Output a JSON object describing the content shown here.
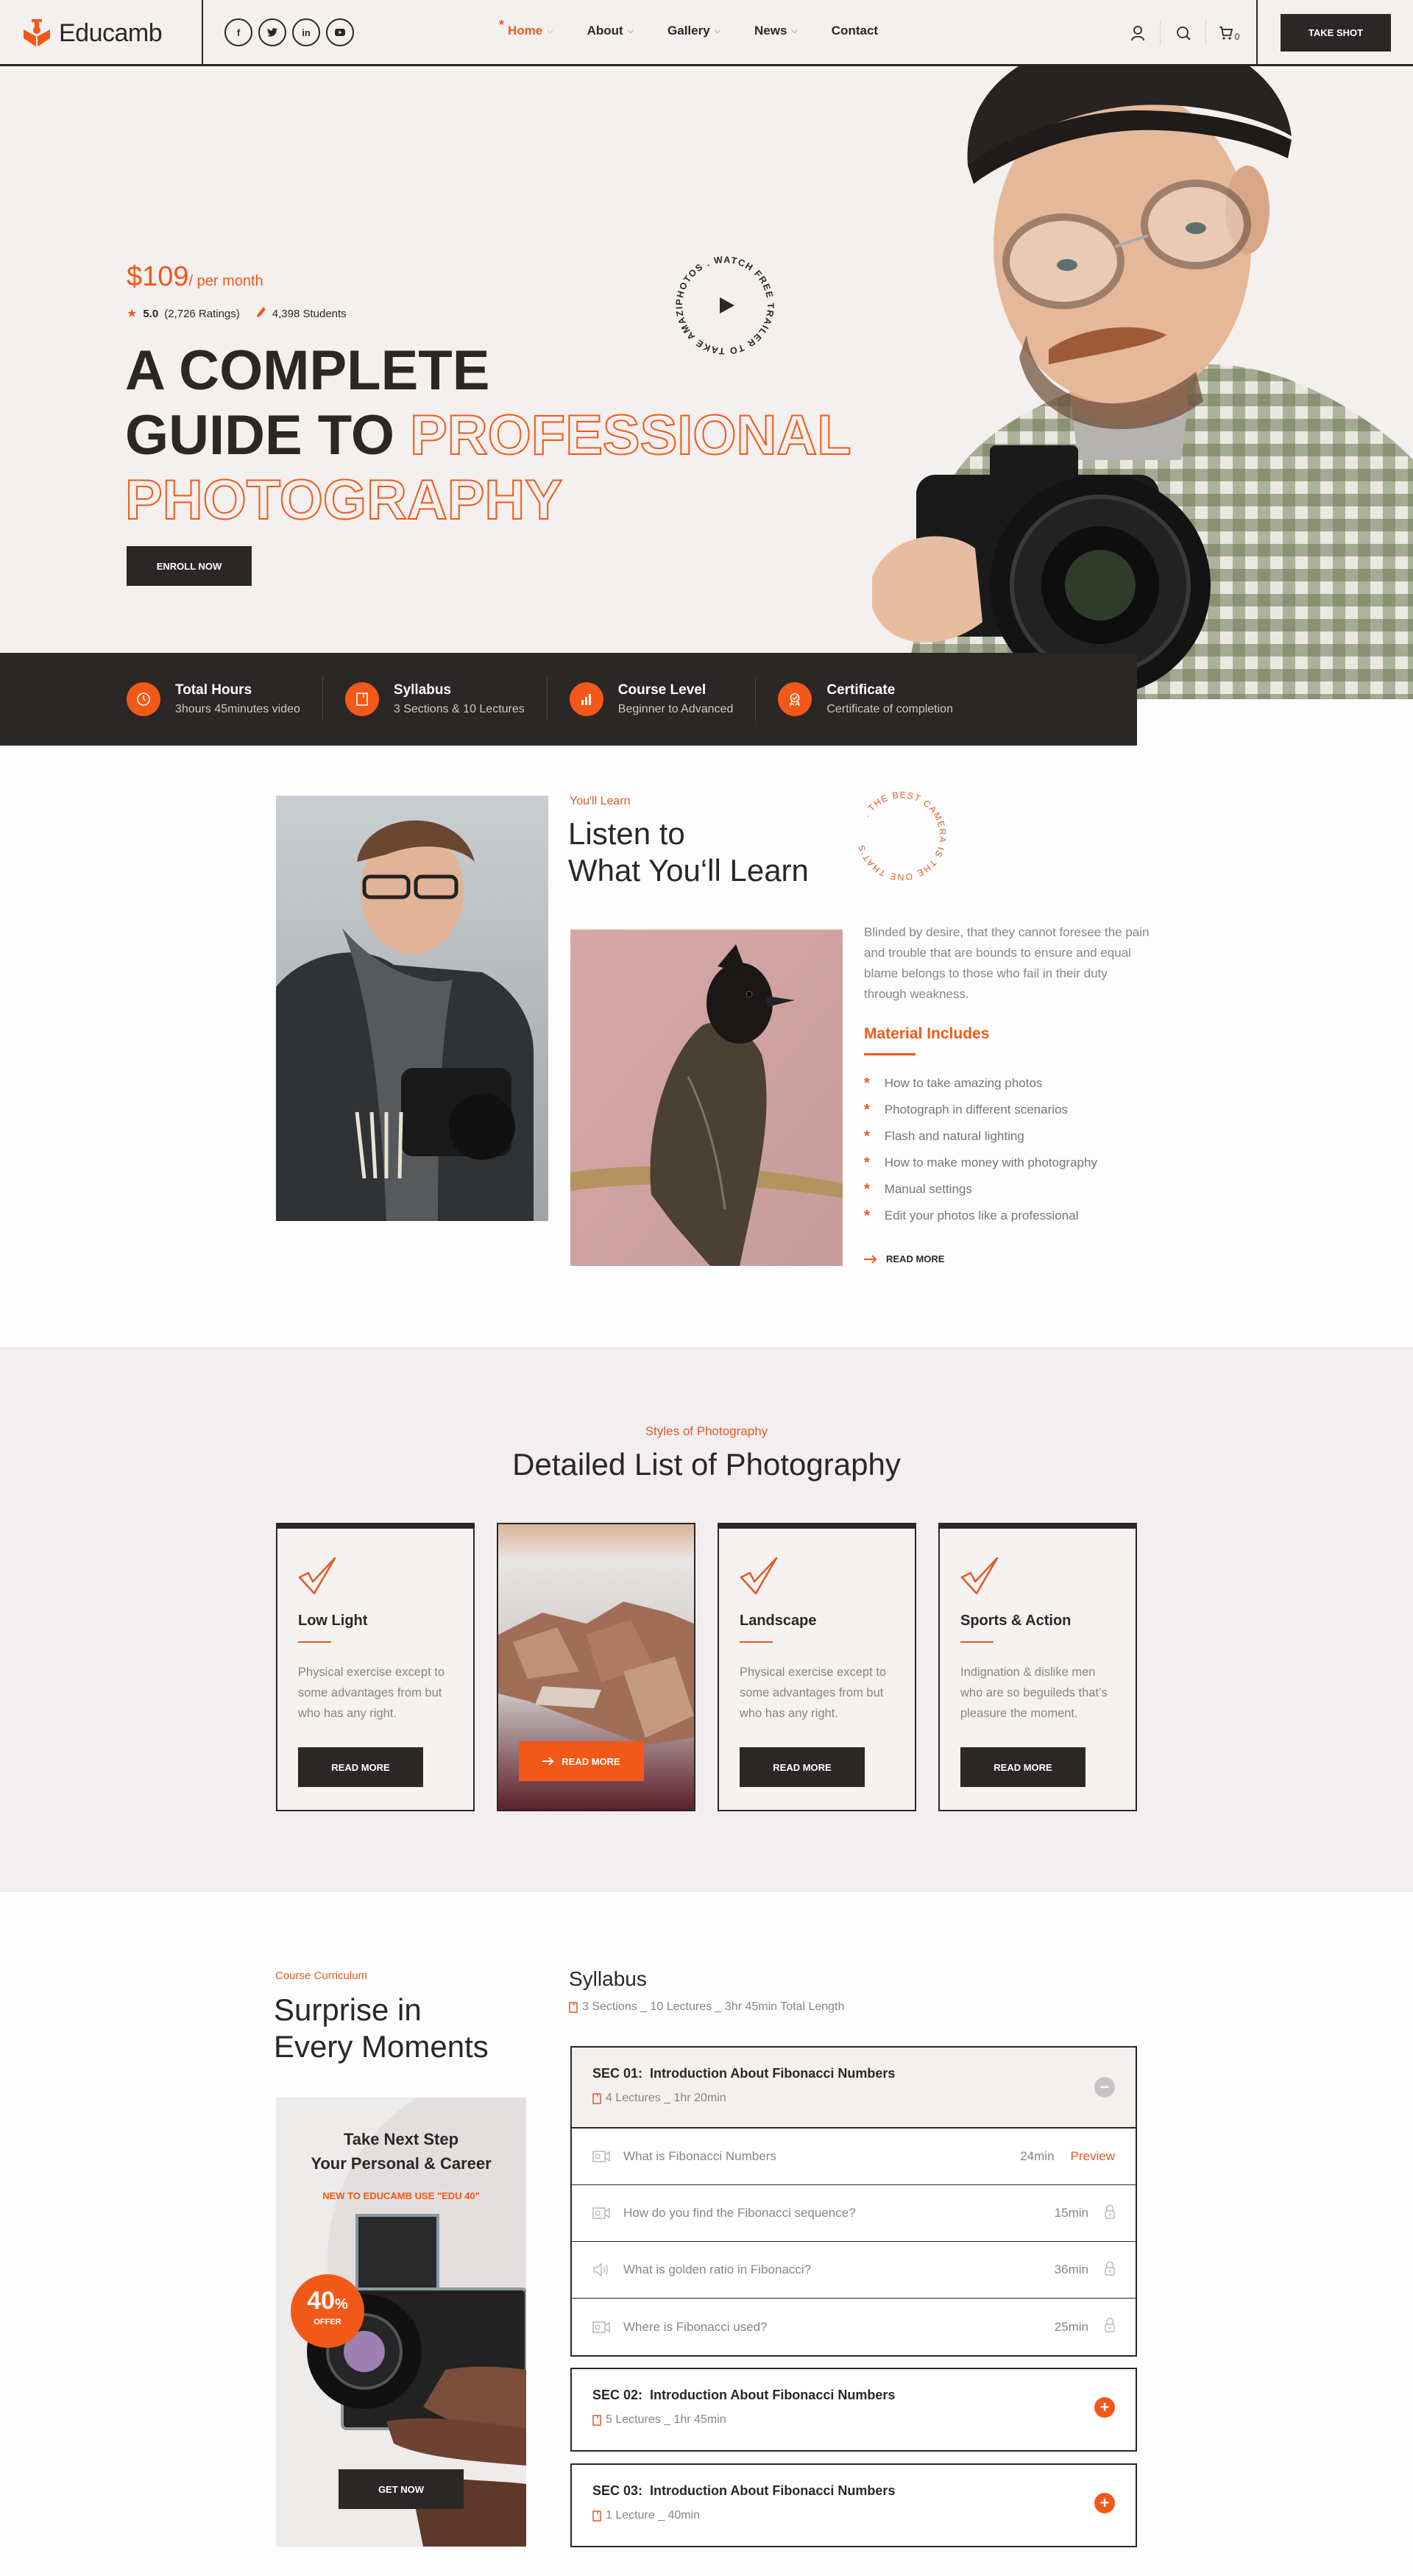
{
  "colors": {
    "accent": "#f25817",
    "dark": "#2b2726",
    "muted": "#8a8483",
    "background": "#f3f0ef"
  },
  "header": {
    "brand": "Educamb",
    "logo_icon": "graduate-book-icon",
    "socials": [
      {
        "name": "facebook-icon",
        "glyph": "f"
      },
      {
        "name": "twitter-icon",
        "glyph": "t"
      },
      {
        "name": "linkedin-icon",
        "glyph": "in"
      },
      {
        "name": "youtube-icon",
        "glyph": "▶"
      }
    ],
    "nav": [
      {
        "label": "Home",
        "has_dropdown": true,
        "active": true
      },
      {
        "label": "About",
        "has_dropdown": true
      },
      {
        "label": "Gallery",
        "has_dropdown": true
      },
      {
        "label": "News",
        "has_dropdown": true
      },
      {
        "label": "Contact",
        "has_dropdown": false
      }
    ],
    "icons": [
      "user-icon",
      "search-icon",
      "cart-icon"
    ],
    "cart_count": "0",
    "cta": "TAKE SHOT"
  },
  "hero": {
    "price": "$109",
    "price_period": "/ per month",
    "rating": "5.0",
    "ratings_count": "(2,726 Ratings)",
    "students": "4,398 Students",
    "title_line1": "A COMPLETE",
    "title_line2_solid": "GUIDE TO",
    "title_line2_outline": "PROFESSIONAL",
    "title_line3_outline": "PHOTOGRAPHY",
    "enroll": "ENROLL NOW",
    "trailer_text": "PHOTOS . WATCH FREE TRAILER TO TAKE AMAZING ",
    "image_alt": "Photographer with beanie and glasses holding a DSLR camera"
  },
  "stats": [
    {
      "icon": "clock-icon",
      "title": "Total Hours",
      "value": "3hours 45minutes video"
    },
    {
      "icon": "book-icon",
      "title": "Syllabus",
      "value": "3 Sections & 10 Lectures"
    },
    {
      "icon": "bar-chart-icon",
      "title": "Course Level",
      "value": "Beginner to Advanced"
    },
    {
      "icon": "award-icon",
      "title": "Certificate",
      "value": "Certificate of completion"
    }
  ],
  "learn": {
    "eyebrow": "You'll Learn",
    "title_line1": "Listen to",
    "title_line2": "What You‘ll Learn",
    "badge_text": ". THE BEST CAMERA IS THE ONE THAT'S WITH ",
    "paragraph": "Blinded by desire, that they cannot foresee the pain and trouble that are bounds to ensure and equal blame belongs to those who fail in their duty through weakness.",
    "materials_title": "Material Includes",
    "materials": [
      "How to take amazing photos",
      "Photograph in different scenarios",
      "Flash and natural lighting",
      "How to make money with photography",
      "Manual settings",
      "Edit your photos like a professional"
    ],
    "read_more": "READ MORE"
  },
  "styles_section": {
    "eyebrow": "Styles of Photography",
    "title": "Detailed List of Photography",
    "cards": [
      {
        "title": "Low Light",
        "desc": "Physical exercise except to some advantages from but who has any right.",
        "button": "READ MORE"
      },
      {
        "title": "",
        "desc": "",
        "button": "READ MORE",
        "is_photo": true
      },
      {
        "title": "Landscape",
        "desc": "Physical exercise except to some advantages from but who has any right.",
        "button": "READ MORE"
      },
      {
        "title": "Sports & Action",
        "desc": "Indignation & dislike men who are so beguileds that’s pleasure the moment.",
        "button": "READ MORE"
      }
    ]
  },
  "curriculum": {
    "eyebrow": "Course Curriculum",
    "title_line1": "Surprise in",
    "title_line2": "Every Moments",
    "promo": {
      "title_line1": "Take Next Step",
      "title_line2": "Your Personal & Career",
      "code": "NEW TO EDUCAMB USE \"EDU 40\"",
      "offer_value": "40",
      "offer_unit": "%",
      "offer_label": "OFFER",
      "button": "GET NOW"
    },
    "syllabus_title": "Syllabus",
    "syllabus_meta": "3 Sections _ 10 Lectures _ 3hr 45min Total Length",
    "sections": [
      {
        "num": "SEC 01:",
        "title": "Introduction About Fibonacci Numbers",
        "meta": "4 Lectures _ 1hr 20min",
        "expanded": true,
        "lessons": [
          {
            "type": "video",
            "title": "What is Fibonacci Numbers",
            "duration": "24min",
            "action": "Preview"
          },
          {
            "type": "video",
            "title": "How do you find the Fibonacci sequence?",
            "duration": "15min",
            "locked": true
          },
          {
            "type": "audio",
            "title": "What is golden ratio in Fibonacci?",
            "duration": "36min",
            "locked": true
          },
          {
            "type": "video",
            "title": "Where is Fibonacci used?",
            "duration": "25min",
            "locked": true
          }
        ]
      },
      {
        "num": "SEC 02:",
        "title": "Introduction About Fibonacci Numbers",
        "meta": "5 Lectures _ 1hr 45min",
        "expanded": false
      },
      {
        "num": "SEC 03:",
        "title": "Introduction About Fibonacci Numbers",
        "meta": "1 Lecture _ 40min",
        "expanded": false
      }
    ]
  }
}
